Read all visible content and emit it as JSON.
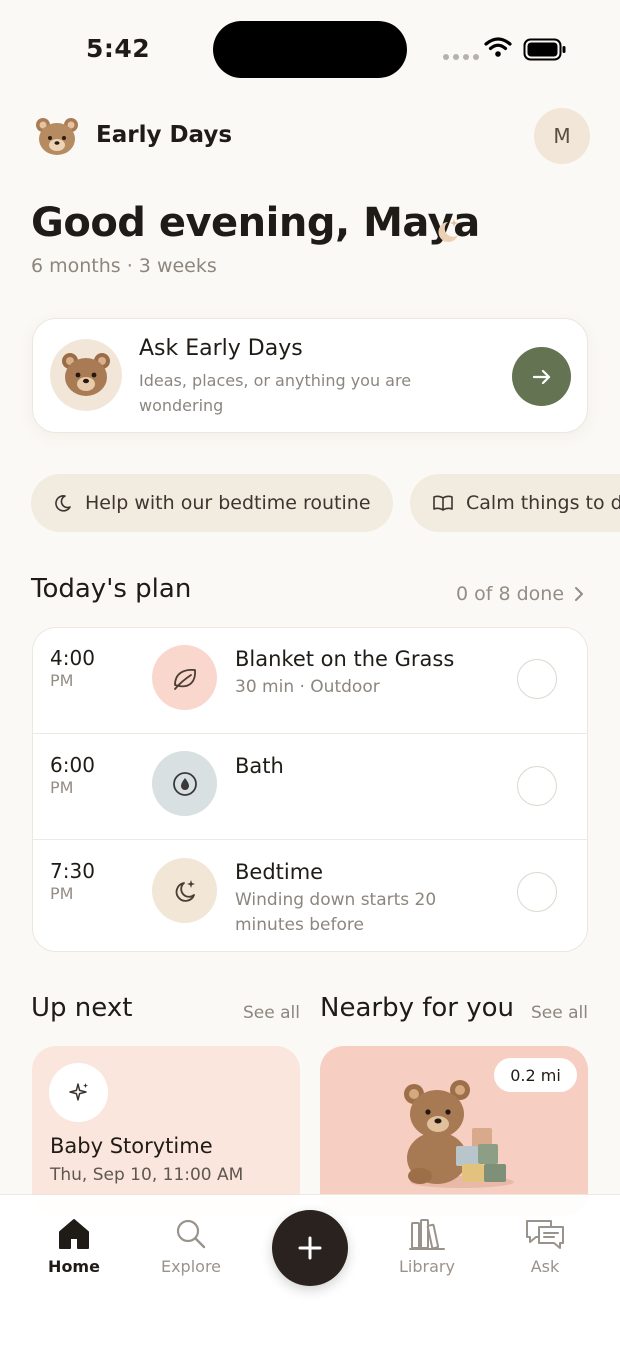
{
  "status_bar": {
    "time": "5:42"
  },
  "header": {
    "app_name": "Early Days",
    "avatar_initial": "M"
  },
  "greeting": {
    "text": "Good evening, Maya",
    "age": "6 months · 3 weeks"
  },
  "ask_card": {
    "title": "Ask Early Days",
    "subtitle": "Ideas, places, or anything you are wondering"
  },
  "chips": [
    {
      "label": "Help with our bedtime routine",
      "icon": "moon-icon"
    },
    {
      "label": "Calm things to do",
      "icon": "book-icon"
    }
  ],
  "plan": {
    "title": "Today's plan",
    "progress": "0 of 8 done",
    "items": [
      {
        "time": "4:00",
        "ampm": "PM",
        "title": "Blanket on the Grass",
        "subtitle": "30 min · Outdoor",
        "icon": "leaf-icon",
        "icon_bg": "#f9d7cd"
      },
      {
        "time": "6:00",
        "ampm": "PM",
        "title": "Bath",
        "subtitle": "",
        "icon": "water-drop-icon",
        "icon_bg": "#d8e0e2"
      },
      {
        "time": "7:30",
        "ampm": "PM",
        "title": "Bedtime",
        "subtitle": "Winding down starts 20 minutes before",
        "icon": "moon-stars-icon",
        "icon_bg": "#f2e6d6"
      }
    ]
  },
  "up_next": {
    "title": "Up next",
    "see_all": "See all",
    "event": {
      "title": "Baby Storytime",
      "date": "Thu, Sep 10, 11:00 AM"
    }
  },
  "nearby": {
    "title": "Nearby for you",
    "see_all": "See all",
    "distance": "0.2 mi"
  },
  "tabbar": {
    "tabs": [
      {
        "label": "Home",
        "icon": "home-icon",
        "active": true
      },
      {
        "label": "Explore",
        "icon": "search-icon",
        "active": false
      },
      {
        "label": "Library",
        "icon": "library-icon",
        "active": false
      },
      {
        "label": "Ask",
        "icon": "chat-icon",
        "active": false
      }
    ]
  },
  "colors": {
    "accent": "#647453",
    "background": "#fbf9f5",
    "fab": "#2a221e"
  }
}
